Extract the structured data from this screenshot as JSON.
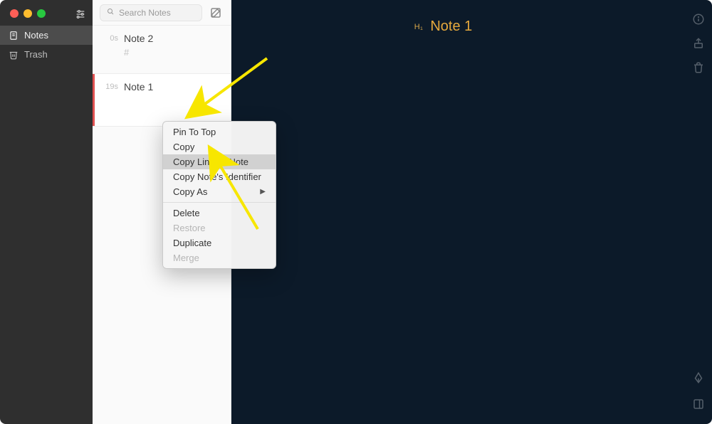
{
  "sidebar": {
    "items": [
      {
        "label": "Notes",
        "icon": "note-icon"
      },
      {
        "label": "Trash",
        "icon": "trash-icon"
      }
    ]
  },
  "search": {
    "placeholder": "Search Notes"
  },
  "notes": [
    {
      "time": "0s",
      "title": "Note 2",
      "snippet": "#"
    },
    {
      "time": "19s",
      "title": "Note 1",
      "snippet": ""
    }
  ],
  "editor": {
    "h1_badge": "H₁",
    "title": "Note 1"
  },
  "context_menu": {
    "items": [
      {
        "label": "Pin To Top",
        "state": "normal"
      },
      {
        "label": "Copy",
        "state": "normal"
      },
      {
        "label": "Copy Link To Note",
        "state": "highlighted"
      },
      {
        "label": "Copy Note's Identifier",
        "state": "normal"
      },
      {
        "label": "Copy As",
        "state": "submenu"
      }
    ],
    "items2": [
      {
        "label": "Delete",
        "state": "normal"
      },
      {
        "label": "Restore",
        "state": "disabled"
      },
      {
        "label": "Duplicate",
        "state": "normal"
      },
      {
        "label": "Merge",
        "state": "disabled"
      }
    ]
  }
}
